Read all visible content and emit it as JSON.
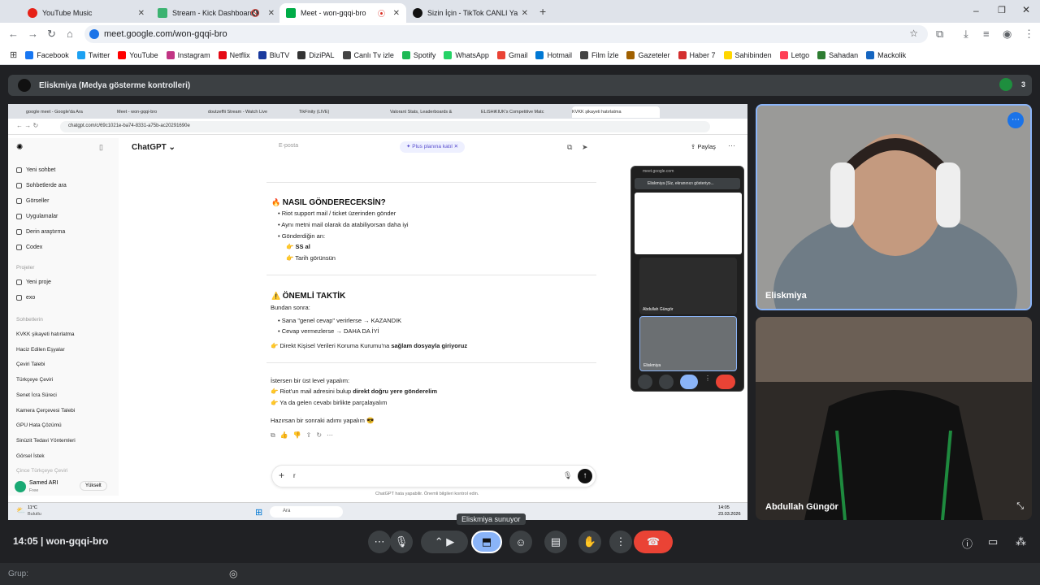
{
  "tabs": [
    {
      "label": "YouTube Music",
      "color": "#e62117"
    },
    {
      "label": "Stream - Kick Dashboard",
      "color": "#3cb371"
    },
    {
      "label": "Meet - won-gqqi-bro",
      "color": "#00ac47"
    },
    {
      "label": "Sizin İçin - TikTok CANLI Ya",
      "color": "#111111"
    }
  ],
  "address": {
    "url": "meet.google.com/won-gqqi-bro"
  },
  "bookmarks": [
    {
      "label": "Facebook",
      "color": "#1877f2"
    },
    {
      "label": "Twitter",
      "color": "#1da1f2"
    },
    {
      "label": "YouTube",
      "color": "#ff0000"
    },
    {
      "label": "Instagram",
      "color": "#c13584"
    },
    {
      "label": "Netflix",
      "color": "#e50914"
    },
    {
      "label": "BluTV",
      "color": "#1a3a9e"
    },
    {
      "label": "DiziPAL",
      "color": "#333333"
    },
    {
      "label": "Canlı Tv izle",
      "color": "#444444"
    },
    {
      "label": "Spotify",
      "color": "#1db954"
    },
    {
      "label": "WhatsApp",
      "color": "#25d366"
    },
    {
      "label": "Gmail",
      "color": "#ea4335"
    },
    {
      "label": "Hotmail",
      "color": "#0078d4"
    },
    {
      "label": "Film İzle",
      "color": "#444444"
    },
    {
      "label": "Gazeteler",
      "color": "#a06000"
    },
    {
      "label": "Haber 7",
      "color": "#d32f2f"
    },
    {
      "label": "Sahibinden",
      "color": "#ffd600"
    },
    {
      "label": "Letgo",
      "color": "#ff3f55"
    },
    {
      "label": "Sahadan",
      "color": "#2e7d32"
    },
    {
      "label": "Mackolik",
      "color": "#1565c0"
    }
  ],
  "presenter": {
    "label": "Eliskmiya (Medya gösterme kontrolleri)",
    "count": "3"
  },
  "inner": {
    "tabs": [
      "google meet - Google'da Ara",
      "Meet - won-gqqi-bro",
      "doutzeffii Stream - Watch Live",
      "TikFinity (LIVE)",
      "Valorant Stats, Leaderboards &",
      "ELiSHiKIUK's Competitive Matc",
      "KVKK şikayeti hatırlatma"
    ],
    "url": "chatgpt.com/c/69c1021e-ba74-8331-a75b-ac20291690e",
    "app_title": "ChatGPT",
    "side_items": [
      "Yeni sohbet",
      "Sohbetlerde ara",
      "Görseller",
      "Uygulamalar",
      "Derin araştırma",
      "Codex"
    ],
    "projects_label": "Projeler",
    "projects": [
      "Yeni proje",
      "exo"
    ],
    "chats_label": "Sohbetlerin",
    "chats": [
      "KVKK şikayeti hatırlatma",
      "Haciz Edilen Eşyalar",
      "Çeviri Talebi",
      "Türkçeye Çeviri",
      "Senet İcra Süreci",
      "Kamera Çerçevesi Talebi",
      "GPU Hata Çözümü",
      "Sinüzit Tedavi Yöntemleri",
      "Görsel İstek",
      "Çince Türkçeye Çeviri"
    ],
    "user": {
      "name": "Samed ARI",
      "plan": "Free",
      "upgrade": "Yükselt"
    },
    "header": {
      "email": "E-posta",
      "plus": "Plus planına katıl",
      "share": "Paylaş"
    },
    "h1": "NASIL GÖNDERECEKSİN?",
    "list1": [
      "Riot support mail / ticket üzerinden gönder",
      "Aynı metni mail olarak da atabiliyorsan daha iyi",
      "Gönderdiğin an:"
    ],
    "sub1": [
      "SS al",
      "Tarih görünsün"
    ],
    "h2": "ÖNEMLİ TAKTİK",
    "p1": "Bundan sonra:",
    "list2": [
      "Sana \"genel cevap\" verirlerse → KAZANDIK",
      "Cevap vermezlerse → DAHA DA İYİ"
    ],
    "kvkk_pre": "Direkt Kişisel Verileri Koruma Kurumu'na ",
    "kvkk_bold": "sağlam dosyayla giriyoruz",
    "p2": "İstersen bir üst level yapalım:",
    "opt1_pre": "Riot'un mail adresini bulup ",
    "opt1_bold": "direkt doğru yere gönderelim",
    "opt2": "Ya da gelen cevabı birlikte parçalayalım",
    "p3": "Hazırsan bir sonraki adımı yapalım 😎",
    "composer_text": "r",
    "disclaimer": "ChatGPT hata yapabilir. Önemli bilgileri kontrol edin.",
    "taskbar": {
      "weather": "11°C",
      "weather_sub": "Bulutlu",
      "search": "Ara",
      "time": "14:05",
      "date": "23.03.2026"
    },
    "pip": {
      "url": "meet.google.com",
      "title": "Eliskmiya (Siz, ekranınızı gösteriyo...",
      "p1": "Abdullah Güngör",
      "p2": "Eliskmiya"
    }
  },
  "participants": [
    {
      "name": "Eliskmiya"
    },
    {
      "name": "Abdullah Güngör"
    }
  ],
  "tooltip": "Eliskmiya sunuyor",
  "footer": {
    "time": "14:05",
    "meeting": "won-gqqi-bro"
  },
  "grup": {
    "label": "Grup:"
  }
}
